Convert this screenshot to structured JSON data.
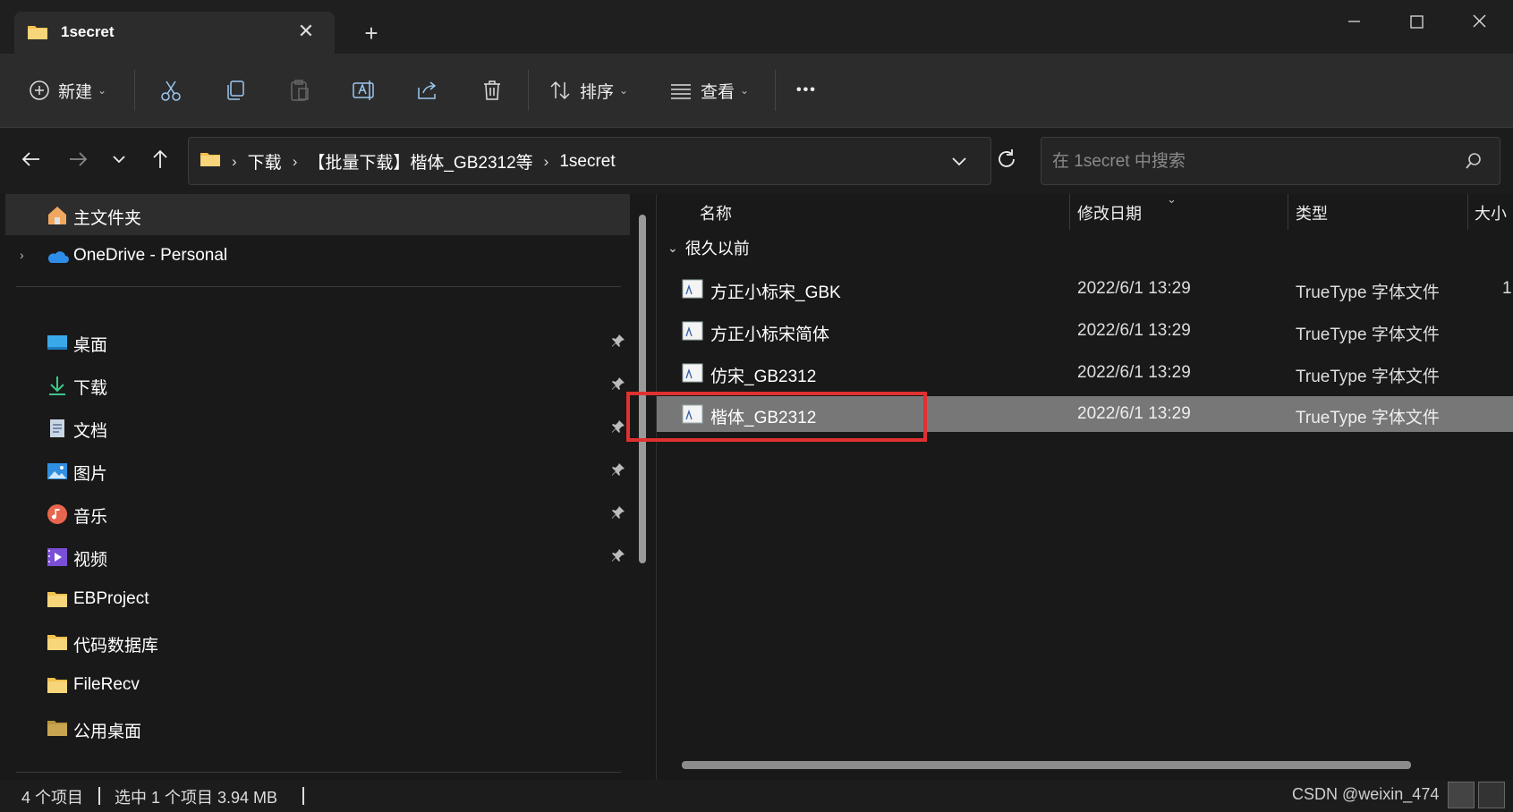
{
  "titlebar": {
    "tab_title": "1secret",
    "new_tab_glyph": "+",
    "close_tab_glyph": "✕",
    "controls": [
      "minimize-icon",
      "maximize-icon",
      "close-icon"
    ]
  },
  "toolbar": {
    "new_label": "新建",
    "sort_label": "排序",
    "view_label": "查看",
    "more_glyph": "•••",
    "icons": [
      "plus-circle-icon",
      "cut-icon",
      "copy-icon",
      "paste-icon",
      "rename-icon",
      "share-icon",
      "delete-icon",
      "sort-icon",
      "view-icon",
      "more-icon"
    ]
  },
  "address": {
    "crumbs": [
      "下载",
      "【批量下载】楷体_GB2312等",
      "1secret"
    ],
    "search_placeholder": "在 1secret 中搜索"
  },
  "sidebar": {
    "top_items": [
      {
        "label": "主文件夹",
        "icon": "home-icon"
      },
      {
        "label": "OneDrive - Personal",
        "icon": "onedrive-cloud-icon"
      }
    ],
    "pinned_items": [
      {
        "label": "桌面",
        "icon": "desktop-icon"
      },
      {
        "label": "下载",
        "icon": "download-icon"
      },
      {
        "label": "文档",
        "icon": "document-icon"
      },
      {
        "label": "图片",
        "icon": "pictures-icon"
      },
      {
        "label": "音乐",
        "icon": "music-icon"
      },
      {
        "label": "视频",
        "icon": "video-icon"
      }
    ],
    "folders": [
      {
        "label": "EBProject"
      },
      {
        "label": "代码数据库"
      },
      {
        "label": "FileRecv"
      },
      {
        "label": "公用桌面"
      }
    ]
  },
  "filelist": {
    "columns": [
      "名称",
      "修改日期",
      "类型",
      "大小"
    ],
    "group_label": "很久以前",
    "rows": [
      {
        "name": "方正小标宋_GBK",
        "date": "2022/6/1 13:29",
        "type": "TrueType 字体文件",
        "size": "1"
      },
      {
        "name": "方正小标宋简体",
        "date": "2022/6/1 13:29",
        "type": "TrueType 字体文件",
        "size": ""
      },
      {
        "name": "仿宋_GB2312",
        "date": "2022/6/1 13:29",
        "type": "TrueType 字体文件",
        "size": ""
      },
      {
        "name": "楷体_GB2312",
        "date": "2022/6/1 13:29",
        "type": "TrueType 字体文件",
        "size": "",
        "selected": true
      }
    ]
  },
  "statusbar": {
    "item_count": "4 个项目",
    "selection": "选中 1 个项目  3.94 MB",
    "watermark": "CSDN @weixin_474"
  },
  "colors": {
    "background": "#191919",
    "toolbar": "#2c2c2c",
    "selected_row": "#777777",
    "highlight_box": "#e03030",
    "folder": "#f2c14e"
  }
}
